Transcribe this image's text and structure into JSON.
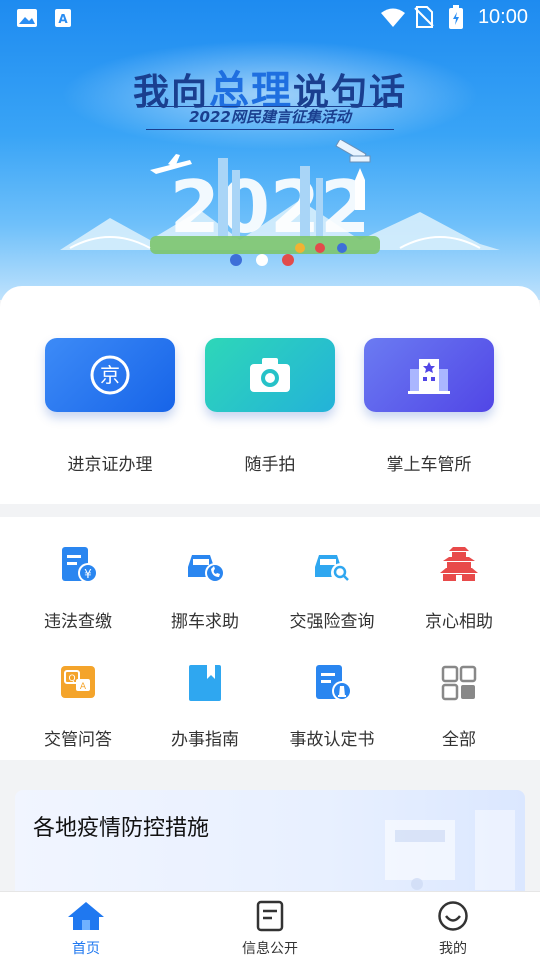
{
  "status_bar": {
    "time": "10:00"
  },
  "banner": {
    "title_part1": "我向",
    "title_highlight": "总理",
    "title_part2": "说句话",
    "subtitle": "2022网民建言征集活动",
    "graphic_year": "2022"
  },
  "services": [
    {
      "label": "进京证办理",
      "icon": "jing-seal-icon"
    },
    {
      "label": "随手拍",
      "icon": "camera-icon"
    },
    {
      "label": "掌上车管所",
      "icon": "building-icon"
    }
  ],
  "grid": [
    {
      "label": "违法查缴",
      "icon": "fine-payment-icon"
    },
    {
      "label": "挪车求助",
      "icon": "move-car-icon"
    },
    {
      "label": "交强险查询",
      "icon": "insurance-query-icon"
    },
    {
      "label": "京心相助",
      "icon": "temple-icon"
    },
    {
      "label": "交管问答",
      "icon": "qa-icon"
    },
    {
      "label": "办事指南",
      "icon": "guide-book-icon"
    },
    {
      "label": "事故认定书",
      "icon": "accident-report-icon"
    },
    {
      "label": "全部",
      "icon": "all-grid-icon"
    }
  ],
  "epidemic_card": {
    "title": "各地疫情防控措施"
  },
  "bottom_nav": [
    {
      "label": "首页",
      "icon": "home-icon",
      "active": true
    },
    {
      "label": "信息公开",
      "icon": "document-icon",
      "active": false
    },
    {
      "label": "我的",
      "icon": "smile-icon",
      "active": false
    }
  ],
  "colors": {
    "accent": "#1f78f0",
    "banner_top": "#1e8bf0",
    "title_dark": "#1a3f8f"
  }
}
